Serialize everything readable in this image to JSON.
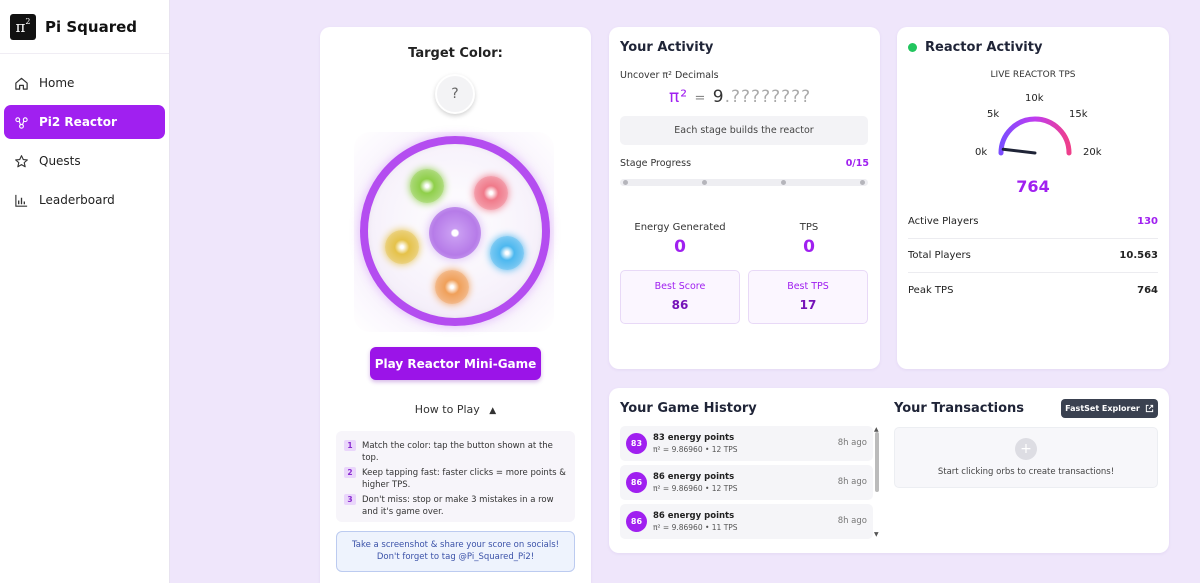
{
  "app": {
    "brand_symbol": "π",
    "brand_sup": "2",
    "brand_name": "Pi Squared"
  },
  "sidebar": {
    "items": [
      {
        "label": "Home",
        "icon": "home-icon",
        "active": false
      },
      {
        "label": "Pi2 Reactor",
        "icon": "reactor-icon",
        "active": true
      },
      {
        "label": "Quests",
        "icon": "star-icon",
        "active": false
      },
      {
        "label": "Leaderboard",
        "icon": "bar-chart-icon",
        "active": false
      }
    ]
  },
  "reactor": {
    "target_label": "Target Color:",
    "target_value": "?",
    "orbs": [
      "#8fcf4a",
      "#f07a8a",
      "#e5c24a",
      "#4db8ef",
      "#f0a05a"
    ],
    "play_button": "Play Reactor Mini-Game",
    "how_to_label": "How to Play",
    "rules": [
      {
        "num": "1",
        "text": "Match the color: tap the button shown at the top."
      },
      {
        "num": "2",
        "text": "Keep tapping fast: faster clicks = more points & higher TPS."
      },
      {
        "num": "3",
        "text": "Don't miss: stop or make 3 mistakes in a row and it's game over."
      }
    ],
    "share_text": "Take a screenshot & share your score on socials! Don't forget to tag @Pi_Squared_Pi2!"
  },
  "activity": {
    "title": "Your Activity",
    "uncover_label": "Uncover π² Decimals",
    "pi_symbol": "π²",
    "pi_eq": "=",
    "pi_int": "9",
    "pi_dots": ".????????",
    "stage_note": "Each stage builds the reactor",
    "stage_label": "Stage Progress",
    "stage_count": "0/15",
    "energy_label": "Energy Generated",
    "energy_value": "0",
    "tps_label": "TPS",
    "tps_value": "0",
    "best_score_label": "Best Score",
    "best_score_value": "86",
    "best_tps_label": "Best TPS",
    "best_tps_value": "17"
  },
  "reactor_activity": {
    "title": "Reactor Activity",
    "live_label": "LIVE REACTOR TPS",
    "gauge_ticks": [
      "0k",
      "5k",
      "10k",
      "15k",
      "20k"
    ],
    "gauge_value": "764",
    "gauge_fraction": 0.038,
    "rows": [
      {
        "label": "Active Players",
        "value": "130",
        "accent": true
      },
      {
        "label": "Total Players",
        "value": "10.563",
        "accent": false
      },
      {
        "label": "Peak TPS",
        "value": "764",
        "accent": false
      }
    ]
  },
  "history": {
    "title": "Your Game History",
    "items": [
      {
        "badge": "83",
        "title": "83 energy points",
        "sub": "π² = 9.86960 • 12 TPS",
        "time": "8h ago"
      },
      {
        "badge": "86",
        "title": "86 energy points",
        "sub": "π² = 9.86960 • 12 TPS",
        "time": "8h ago"
      },
      {
        "badge": "86",
        "title": "86 energy points",
        "sub": "π² = 9.86960 • 11 TPS",
        "time": "8h ago"
      }
    ]
  },
  "transactions": {
    "title": "Your Transactions",
    "explorer_button": "FastSet Explorer",
    "empty_icon": "+",
    "empty_text": "Start clicking orbs to create transactions!"
  },
  "colors": {
    "accent": "#a020f0",
    "background": "#efe6fb",
    "live": "#22c55e"
  }
}
